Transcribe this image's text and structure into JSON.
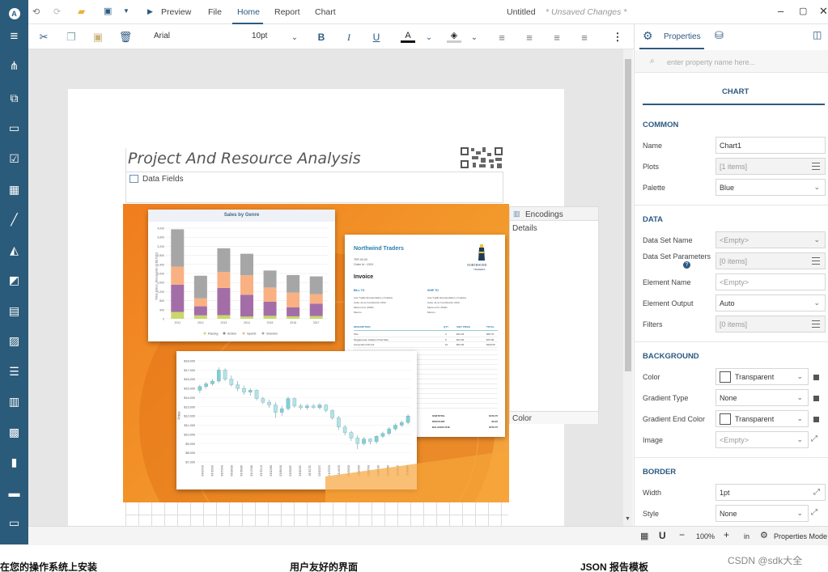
{
  "title": {
    "doc": "Untitled",
    "status": "* Unsaved Changes *"
  },
  "menu": {
    "preview": "Preview",
    "file": "File",
    "home": "Home",
    "report": "Report",
    "chart": "Chart"
  },
  "toolbar": {
    "font": "Arial",
    "size": "10pt",
    "bold": "B",
    "italic": "I",
    "underline": "U",
    "font_color_letter": "A"
  },
  "colors": {
    "sidebar": "#2b5b7a",
    "accent": "#2c5a82",
    "orange": "#f07d1e"
  },
  "report": {
    "title": "Project And Resource Analysis",
    "data_fields": "Data Fields",
    "encodings": "Encodings",
    "details": "Details",
    "color": "Color"
  },
  "invoice": {
    "brand": "Northwind Traders",
    "heading": "Invoice",
    "logo_text": "NORTHWIND",
    "logo_sub": "TRADERS",
    "ref1": "TRF-00-00",
    "ref2": "Order Id : 10XX",
    "bill_to": "BILL TO",
    "ship_to": "SHIP TO",
    "bill_lines": [
      "Ana Trujillo Emparedados y helados",
      "Avda. de la Constitución 2222",
      "México D.F. 05021",
      "Mexico"
    ],
    "ship_lines": [
      "Ana Trujillo Emparedados y helados",
      "Avda. de la Constitución 2222",
      "México D.F. 05021",
      "Mexico"
    ],
    "cols": [
      "DESCRIPTION",
      "QTY",
      "UNIT PRICE",
      "TOTAL"
    ],
    "rows": [
      [
        "Tofu",
        "3",
        "$23.25",
        "$69.75"
      ],
      [
        "Singaporean Hokkien Fried Mee",
        "5",
        "$14.00",
        "$70.00"
      ],
      [
        "Camembert Pierrot",
        "10",
        "$34.00",
        "$340.00"
      ]
    ],
    "totals": [
      [
        "SUBTOTAL",
        "$479.75"
      ],
      [
        "DISCOUNT",
        "$0.00"
      ],
      [
        "BALANCE DUE",
        "$479.75"
      ]
    ]
  },
  "chart_data": [
    {
      "type": "bar",
      "title": "Sales by Genre",
      "ylabel": "Total Sales, thousands of $(USD)",
      "categories": [
        "2011",
        "2012",
        "2013",
        "2014",
        "2015",
        "2016",
        "2017"
      ],
      "yticks": [
        "4,000",
        "3,600",
        "3,200",
        "2,800",
        "2,400",
        "2,000",
        "1,600",
        "1,200",
        "800",
        "400",
        "0"
      ],
      "ylim": [
        0,
        4000
      ],
      "series": [
        {
          "name": "Racing",
          "color": "#c8d86b",
          "values": [
            300,
            150,
            160,
            100,
            130,
            110,
            120
          ]
        },
        {
          "name": "Action",
          "color": "#a36ea8",
          "values": [
            1200,
            400,
            1200,
            960,
            620,
            400,
            550
          ]
        },
        {
          "name": "Sports",
          "color": "#f9b183",
          "values": [
            800,
            350,
            700,
            860,
            630,
            640,
            420
          ]
        },
        {
          "name": "Shooter",
          "color": "#a6a6a6",
          "values": [
            1650,
            1000,
            1050,
            950,
            750,
            780,
            780
          ]
        }
      ],
      "legend": "bottom"
    },
    {
      "type": "candlestick",
      "ylabel": "Price",
      "yticks": [
        "$18,000",
        "$17,000",
        "$16,000",
        "$15,000",
        "$14,000",
        "$13,000",
        "$12,000",
        "$11,000",
        "$10,000",
        "$9,000",
        "$8,000",
        "$7,000"
      ],
      "ylim": [
        7000,
        18000
      ],
      "candles": [
        [
          14800,
          15400,
          14500,
          15200
        ],
        [
          15200,
          15700,
          15000,
          15500
        ],
        [
          15500,
          16000,
          15300,
          15800
        ],
        [
          15800,
          17300,
          15600,
          17000
        ],
        [
          17000,
          17200,
          15800,
          16000
        ],
        [
          16000,
          16400,
          15200,
          15400
        ],
        [
          15400,
          15800,
          14700,
          15000
        ],
        [
          15000,
          15300,
          14300,
          14600
        ],
        [
          14600,
          15000,
          14200,
          14800
        ],
        [
          14800,
          14900,
          13700,
          13900
        ],
        [
          13900,
          14100,
          13300,
          13500
        ],
        [
          13500,
          13800,
          12900,
          13200
        ],
        [
          13200,
          13500,
          11800,
          12400
        ],
        [
          12400,
          13100,
          12000,
          12800
        ],
        [
          12800,
          14100,
          12600,
          13900
        ],
        [
          13900,
          14000,
          12900,
          13100
        ],
        [
          13100,
          13300,
          12700,
          12900
        ],
        [
          12900,
          13300,
          12700,
          13100
        ],
        [
          13100,
          13300,
          12800,
          12900
        ],
        [
          12900,
          13400,
          12700,
          13200
        ],
        [
          13200,
          13300,
          12400,
          12600
        ],
        [
          12600,
          12700,
          11600,
          11800
        ],
        [
          11800,
          12000,
          10500,
          10800
        ],
        [
          10800,
          11000,
          9900,
          10200
        ],
        [
          10200,
          10400,
          9300,
          9600
        ],
        [
          9600,
          9900,
          8400,
          9000
        ],
        [
          9000,
          9700,
          8800,
          9500
        ],
        [
          9500,
          9600,
          8900,
          9200
        ],
        [
          9200,
          9900,
          9000,
          9800
        ],
        [
          9800,
          10300,
          9600,
          10100
        ],
        [
          10100,
          10800,
          9900,
          10600
        ],
        [
          10600,
          11200,
          10400,
          11000
        ],
        [
          11000,
          11500,
          10800,
          11300
        ],
        [
          11300,
          12200,
          11100,
          12000
        ]
      ],
      "xticks": [
        "02/23/16",
        "03/21/16",
        "04/12/16",
        "05/09/16",
        "06/01/16",
        "06/27/16",
        "07/21/16",
        "08/15/16",
        "09/08/16",
        "10/03/16",
        "10/26/16",
        "11/21/16",
        "12/16/16",
        "01/12/17",
        "02/07/17",
        "03/03/17",
        "03/29/17",
        "04/24/17",
        "05/18/17",
        "06/13/17",
        "07/07/17",
        "08/01/17"
      ]
    }
  ],
  "props": {
    "tab": "Properties",
    "search_placeholder": "enter property name here...",
    "chart_tab": "CHART",
    "common": "COMMON",
    "name_label": "Name",
    "name_value": "Chart1",
    "plots_label": "Plots",
    "plots_value": "[1 items]",
    "palette_label": "Palette",
    "palette_value": "Blue",
    "data": "DATA",
    "dataset_label": "Data Set Name",
    "dataset_value": "<Empty>",
    "params_label": "Data Set Parameters",
    "params_value": "[0 items]",
    "element_name_label": "Element Name",
    "element_name_value": "<Empty>",
    "element_output_label": "Element Output",
    "element_output_value": "Auto",
    "filters_label": "Filters",
    "filters_value": "[0 items]",
    "background": "BACKGROUND",
    "color_label": "Color",
    "color_value": "Transparent",
    "gradient_label": "Gradient Type",
    "gradient_value": "None",
    "gradient_end_label": "Gradient End Color",
    "gradient_end_value": "Transparent",
    "image_label": "Image",
    "image_value": "<Empty>",
    "border": "BORDER",
    "width_label": "Width",
    "width_value": "1pt",
    "style_label": "Style",
    "style_value": "None"
  },
  "status": {
    "zoom": "100%",
    "unit": "in",
    "mode": "Properties Mode"
  },
  "captions": {
    "c1": "在您的操作系统上安装",
    "c2": "用户友好的界面",
    "c3": "JSON 报告模板",
    "watermark": "CSDN @sdk大全"
  }
}
